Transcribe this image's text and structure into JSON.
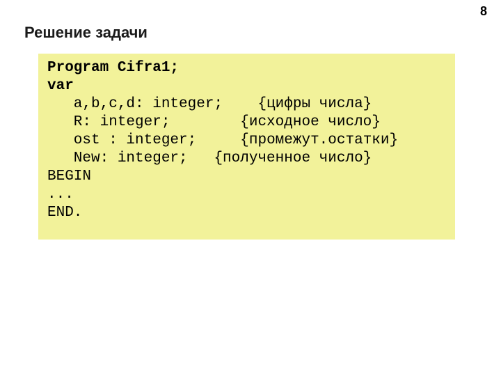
{
  "page_number": "8",
  "title": "Решение задачи",
  "code": {
    "l1": "Program Cifra1;",
    "l2": "var",
    "l3_a": "   a,b,c,d: integer;",
    "l3_b": "    {цифры числа}",
    "l4_a": "   R: integer;",
    "l4_b": "        {исходное число}",
    "l5_a": "   ost : integer;",
    "l5_b": "     {промежут.остатки}",
    "l6_a": "   New: integer;",
    "l6_b": "   {полученное число}",
    "l7": "BEGIN",
    "l8": "...",
    "l9": "END."
  }
}
